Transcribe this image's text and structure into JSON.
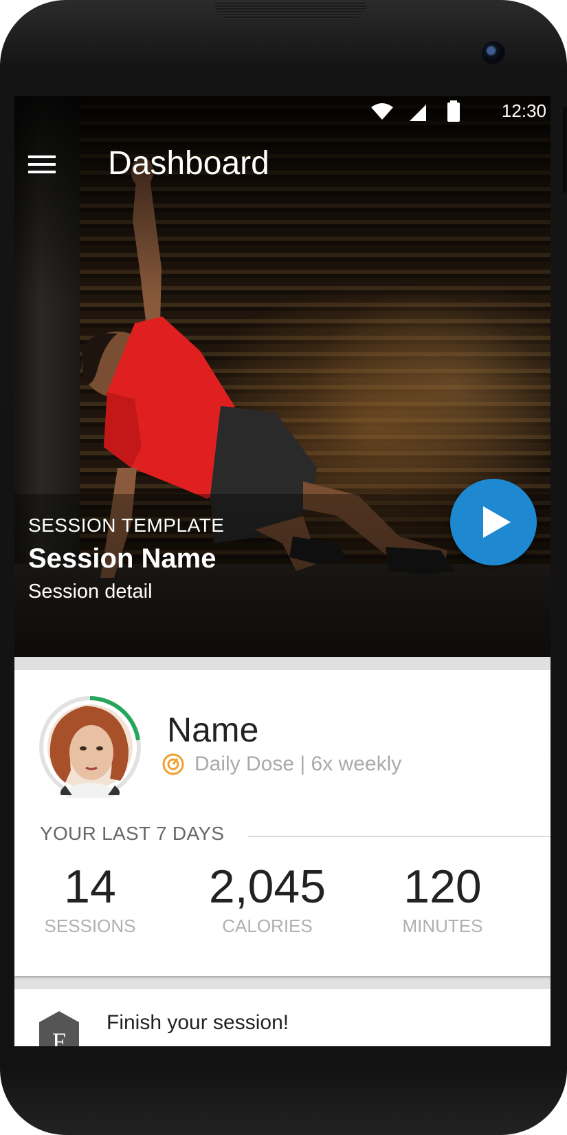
{
  "status_bar": {
    "time": "12:30",
    "icons": [
      "wifi-icon",
      "signal-icon",
      "battery-icon"
    ]
  },
  "app_bar": {
    "title": "Dashboard",
    "menu_icon": "hamburger-menu-icon"
  },
  "hero": {
    "eyebrow": "SESSION TEMPLATE",
    "session_name": "Session Name",
    "session_detail": "Session detail",
    "play_icon": "play-icon",
    "play_color": "#1e88d0"
  },
  "profile": {
    "name": "Name",
    "plan_icon": "gauge-icon",
    "plan": "Daily Dose | 6x weekly",
    "progress_ring_fraction": 0.2,
    "ring_color": "#26a65b",
    "plan_icon_color": "#f0a030"
  },
  "stats": {
    "heading": "YOUR LAST 7 DAYS",
    "items": [
      {
        "value": "14",
        "label": "SESSIONS"
      },
      {
        "value": "2,045",
        "label": "CALORIES"
      },
      {
        "value": "120",
        "label": "MINUTES"
      }
    ]
  },
  "next_card": {
    "badge_letter": "F",
    "text": "Finish your session!"
  }
}
